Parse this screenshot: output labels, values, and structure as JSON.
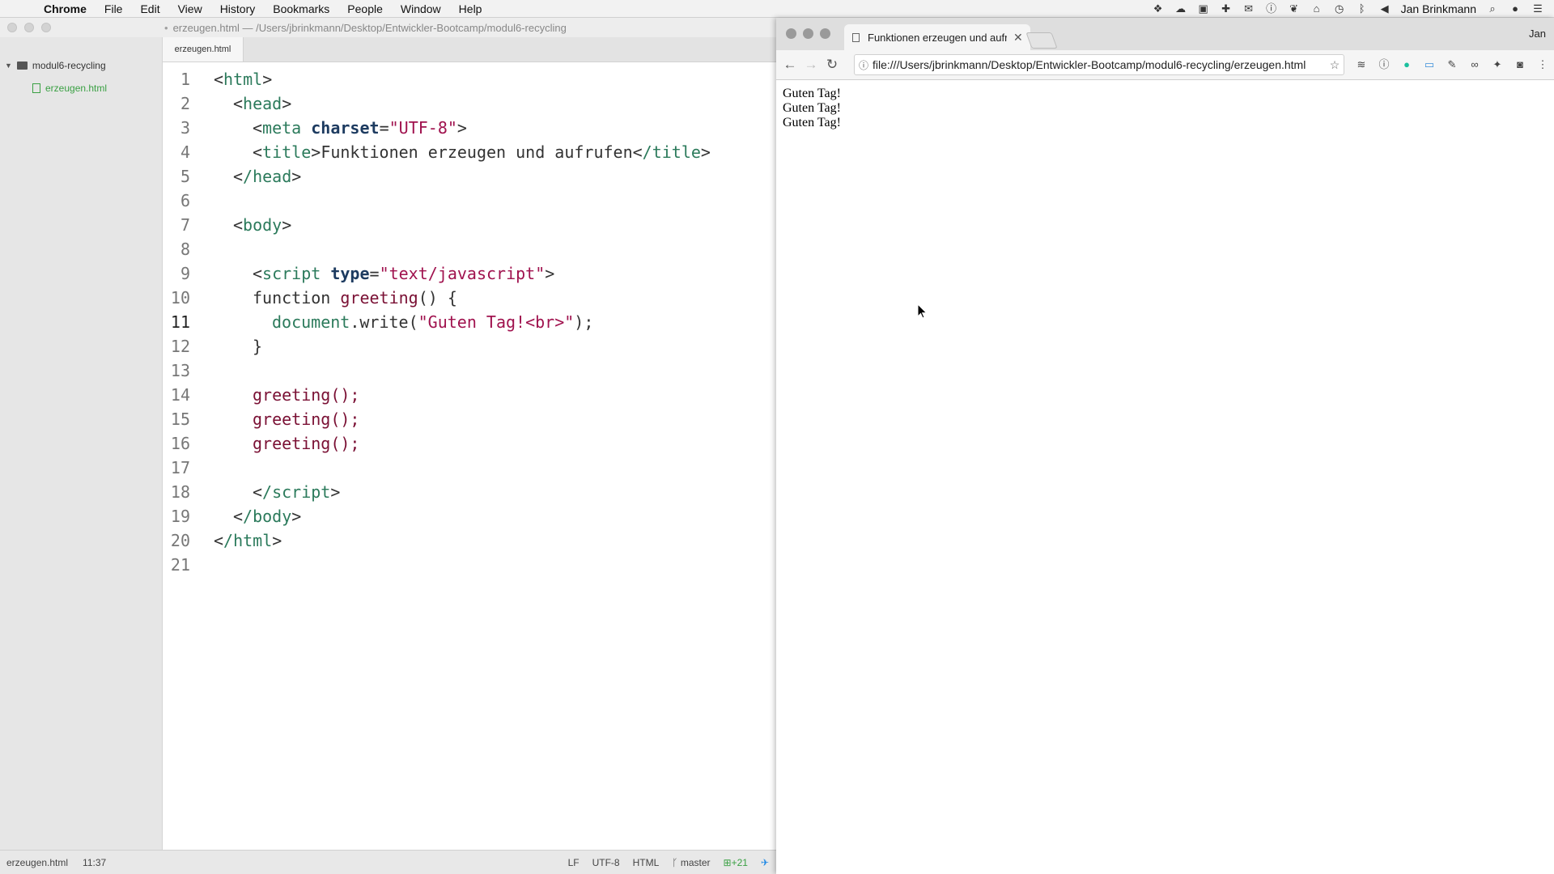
{
  "menubar": {
    "app": "Chrome",
    "items": [
      "File",
      "Edit",
      "View",
      "History",
      "Bookmarks",
      "People",
      "Window",
      "Help"
    ],
    "user": "Jan Brinkmann"
  },
  "editor": {
    "title": "erzeugen.html — /Users/jbrinkmann/Desktop/Entwickler-Bootcamp/modul6-recycling",
    "tree": {
      "folder": "modul6-recycling",
      "file": "erzeugen.html"
    },
    "tab": "erzeugen.html",
    "line_numbers": [
      "1",
      "2",
      "3",
      "4",
      "5",
      "6",
      "7",
      "8",
      "9",
      "10",
      "11",
      "12",
      "13",
      "14",
      "15",
      "16",
      "17",
      "18",
      "19",
      "20",
      "21"
    ],
    "current_line": "11",
    "code": {
      "l1_open": "<",
      "l1_tag": "html",
      "l1_close": ">",
      "l2": "head",
      "l3_tag": "meta",
      "l3_attr": "charset",
      "l3_val": "\"UTF-8\"",
      "l4_tag": "title",
      "l4_text": "Funktionen erzeugen und aufrufen",
      "l4_end": "/title",
      "l5": "/head",
      "l7": "body",
      "l9_tag": "script",
      "l9_attr": "type",
      "l9_val": "\"text/javascript\"",
      "l10_kw": "function ",
      "l10_fn": "greeting",
      "l10_rest": "() {",
      "l11_obj": "document",
      "l11_method": ".write(",
      "l11_str": "\"Guten Tag!<br>\"",
      "l11_end": ");",
      "l12": "}",
      "l14": "greeting();",
      "l15": "greeting();",
      "l16": "greeting();",
      "l18": "/script",
      "l19": "/body",
      "l20": "/html"
    },
    "status": {
      "file": "erzeugen.html",
      "cursor": "11:37",
      "line_ending": "LF",
      "encoding": "UTF-8",
      "grammar": "HTML",
      "branch": "master",
      "diff": "+21"
    }
  },
  "browser": {
    "tab_title": "Funktionen erzeugen und aufrufen",
    "profile": "Jan",
    "url": "file:///Users/jbrinkmann/Desktop/Entwickler-Bootcamp/modul6-recycling/erzeugen.html",
    "output": [
      "Guten Tag!",
      "Guten Tag!",
      "Guten Tag!"
    ]
  }
}
